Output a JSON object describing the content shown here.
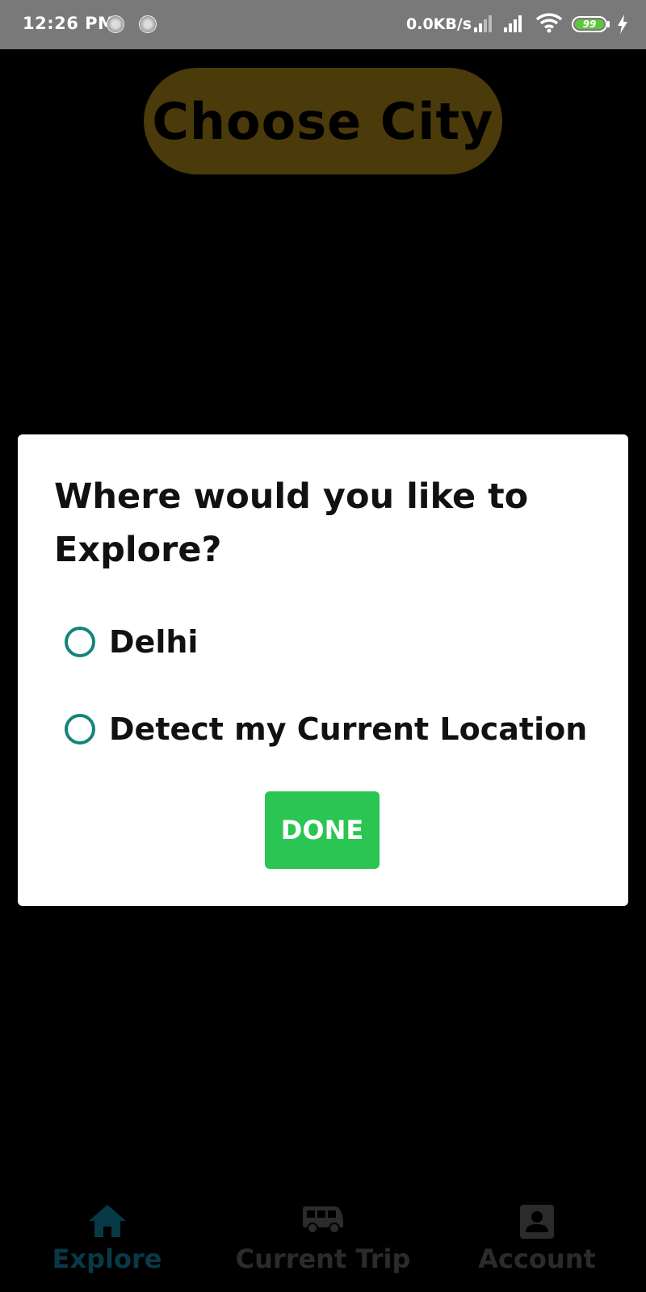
{
  "status_bar": {
    "time": "12:26 PM",
    "network_speed": "0.0KB/s",
    "battery_level": "99"
  },
  "header": {
    "title": "Choose City"
  },
  "dialog": {
    "title": "Where would you like to Explore?",
    "options": [
      {
        "label": "Delhi"
      },
      {
        "label": "Detect my Current Location"
      }
    ],
    "done_label": "DONE"
  },
  "bottom_nav": {
    "items": [
      {
        "label": "Explore",
        "icon": "home-icon",
        "active": true
      },
      {
        "label": "Current Trip",
        "icon": "bus-icon",
        "active": false
      },
      {
        "label": "Account",
        "icon": "account-box-icon",
        "active": false
      }
    ]
  },
  "colors": {
    "accent_radio": "#12857a",
    "done_button": "#2ac552",
    "active_nav": "#073947"
  }
}
